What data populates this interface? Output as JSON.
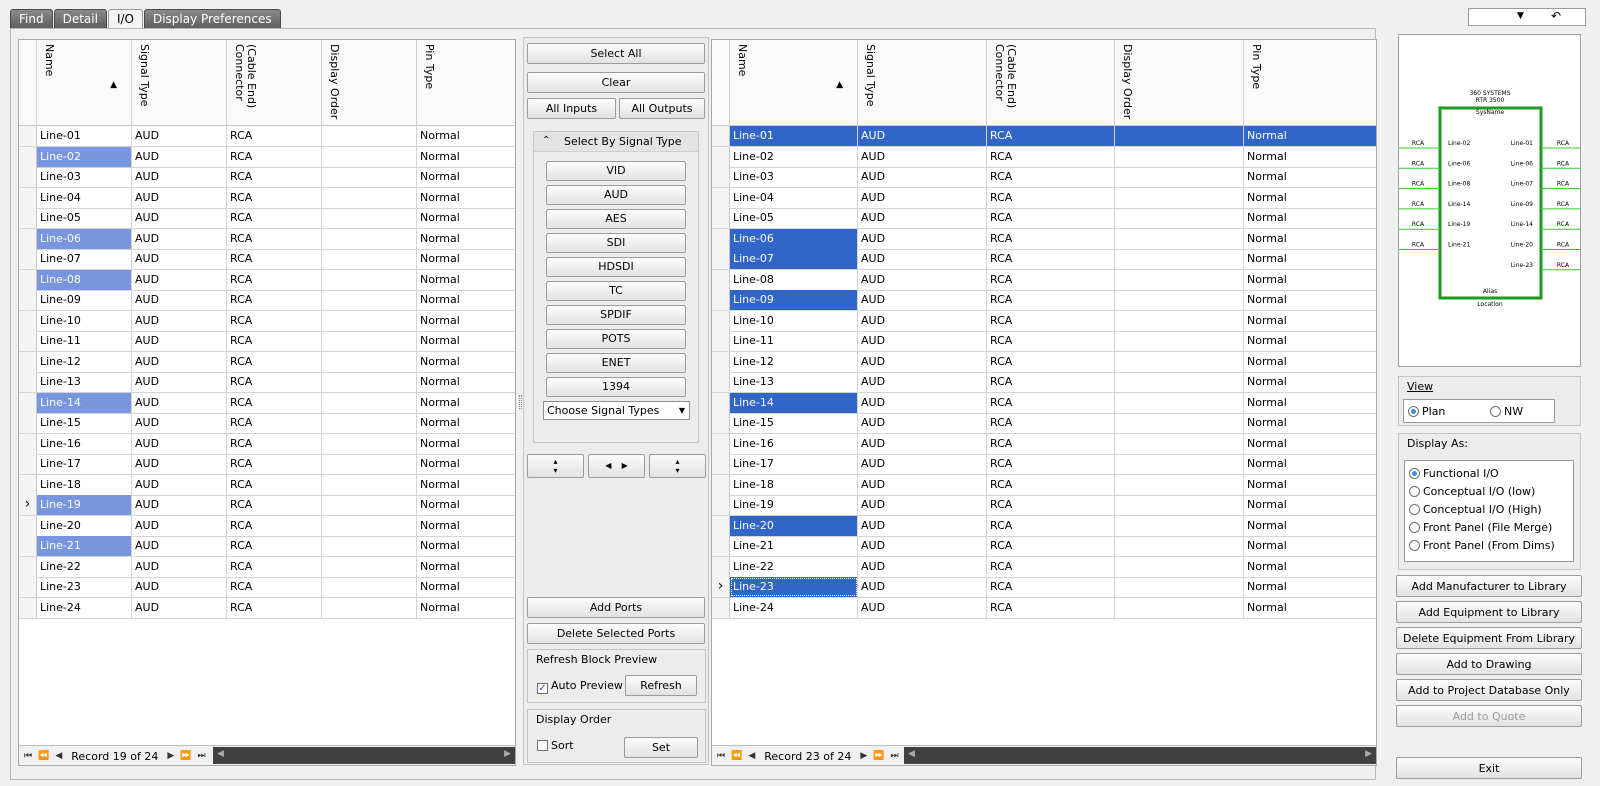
{
  "tabs": [
    {
      "label": "Find",
      "active": false
    },
    {
      "label": "Detail",
      "active": false
    },
    {
      "label": "I/O",
      "active": true
    },
    {
      "label": "Display Preferences",
      "active": false
    }
  ],
  "grid_columns": [
    "Name",
    "Signal Type",
    "(Cable End)\nConnector",
    "Display Order",
    "Pin Type"
  ],
  "left_grid": {
    "rows": [
      [
        "Line-01",
        "AUD",
        "RCA",
        "",
        "Normal"
      ],
      [
        "Line-02",
        "AUD",
        "RCA",
        "",
        "Normal"
      ],
      [
        "Line-03",
        "AUD",
        "RCA",
        "",
        "Normal"
      ],
      [
        "Line-04",
        "AUD",
        "RCA",
        "",
        "Normal"
      ],
      [
        "Line-05",
        "AUD",
        "RCA",
        "",
        "Normal"
      ],
      [
        "Line-06",
        "AUD",
        "RCA",
        "",
        "Normal"
      ],
      [
        "Line-07",
        "AUD",
        "RCA",
        "",
        "Normal"
      ],
      [
        "Line-08",
        "AUD",
        "RCA",
        "",
        "Normal"
      ],
      [
        "Line-09",
        "AUD",
        "RCA",
        "",
        "Normal"
      ],
      [
        "Line-10",
        "AUD",
        "RCA",
        "",
        "Normal"
      ],
      [
        "Line-11",
        "AUD",
        "RCA",
        "",
        "Normal"
      ],
      [
        "Line-12",
        "AUD",
        "RCA",
        "",
        "Normal"
      ],
      [
        "Line-13",
        "AUD",
        "RCA",
        "",
        "Normal"
      ],
      [
        "Line-14",
        "AUD",
        "RCA",
        "",
        "Normal"
      ],
      [
        "Line-15",
        "AUD",
        "RCA",
        "",
        "Normal"
      ],
      [
        "Line-16",
        "AUD",
        "RCA",
        "",
        "Normal"
      ],
      [
        "Line-17",
        "AUD",
        "RCA",
        "",
        "Normal"
      ],
      [
        "Line-18",
        "AUD",
        "RCA",
        "",
        "Normal"
      ],
      [
        "Line-19",
        "AUD",
        "RCA",
        "",
        "Normal"
      ],
      [
        "Line-20",
        "AUD",
        "RCA",
        "",
        "Normal"
      ],
      [
        "Line-21",
        "AUD",
        "RCA",
        "",
        "Normal"
      ],
      [
        "Line-22",
        "AUD",
        "RCA",
        "",
        "Normal"
      ],
      [
        "Line-23",
        "AUD",
        "RCA",
        "",
        "Normal"
      ],
      [
        "Line-24",
        "AUD",
        "RCA",
        "",
        "Normal"
      ]
    ],
    "selected_rows": [
      1,
      5,
      7,
      13,
      18,
      20
    ],
    "current_row": 18,
    "record_text": "Record 19 of 24"
  },
  "right_grid": {
    "rows": [
      [
        "Line-01",
        "AUD",
        "RCA",
        "",
        "Normal"
      ],
      [
        "Line-02",
        "AUD",
        "RCA",
        "",
        "Normal"
      ],
      [
        "Line-03",
        "AUD",
        "RCA",
        "",
        "Normal"
      ],
      [
        "Line-04",
        "AUD",
        "RCA",
        "",
        "Normal"
      ],
      [
        "Line-05",
        "AUD",
        "RCA",
        "",
        "Normal"
      ],
      [
        "Line-06",
        "AUD",
        "RCA",
        "",
        "Normal"
      ],
      [
        "Line-07",
        "AUD",
        "RCA",
        "",
        "Normal"
      ],
      [
        "Line-08",
        "AUD",
        "RCA",
        "",
        "Normal"
      ],
      [
        "Line-09",
        "AUD",
        "RCA",
        "",
        "Normal"
      ],
      [
        "Line-10",
        "AUD",
        "RCA",
        "",
        "Normal"
      ],
      [
        "Line-11",
        "AUD",
        "RCA",
        "",
        "Normal"
      ],
      [
        "Line-12",
        "AUD",
        "RCA",
        "",
        "Normal"
      ],
      [
        "Line-13",
        "AUD",
        "RCA",
        "",
        "Normal"
      ],
      [
        "Line-14",
        "AUD",
        "RCA",
        "",
        "Normal"
      ],
      [
        "Line-15",
        "AUD",
        "RCA",
        "",
        "Normal"
      ],
      [
        "Line-16",
        "AUD",
        "RCA",
        "",
        "Normal"
      ],
      [
        "Line-17",
        "AUD",
        "RCA",
        "",
        "Normal"
      ],
      [
        "Line-18",
        "AUD",
        "RCA",
        "",
        "Normal"
      ],
      [
        "Line-19",
        "AUD",
        "RCA",
        "",
        "Normal"
      ],
      [
        "Line-20",
        "AUD",
        "RCA",
        "",
        "Normal"
      ],
      [
        "Line-21",
        "AUD",
        "RCA",
        "",
        "Normal"
      ],
      [
        "Line-22",
        "AUD",
        "RCA",
        "",
        "Normal"
      ],
      [
        "Line-23",
        "AUD",
        "RCA",
        "",
        "Normal"
      ],
      [
        "Line-24",
        "AUD",
        "RCA",
        "",
        "Normal"
      ]
    ],
    "full_row_selected": 0,
    "selected_rows": [
      5,
      6,
      8,
      13,
      19,
      22
    ],
    "current_row": 22,
    "record_text": "Record 23 of 24"
  },
  "middle": {
    "select_all": "Select All",
    "clear": "Clear",
    "all_inputs": "All Inputs",
    "all_outputs": "All Outputs",
    "signal_panel_title": "Select By Signal Type",
    "signal_buttons": [
      "VID",
      "AUD",
      "AES",
      "SDI",
      "HDSDI",
      "TC",
      "SPDIF",
      "POTS",
      "ENET",
      "1394"
    ],
    "signal_combo": "Choose Signal Types",
    "add_ports": "Add Ports",
    "delete_ports": "Delete Selected Ports",
    "refresh_panel_title": "Refresh Block Preview",
    "auto_preview": "Auto Preview",
    "auto_preview_checked": true,
    "refresh": "Refresh",
    "order_panel_title": "Display Order",
    "sort": "Sort",
    "sort_checked": false,
    "set": "Set"
  },
  "preview": {
    "manufacturer": "360 SYSTEMS",
    "model": "RTR 3500",
    "sysname": "SysName",
    "alias": "Alias",
    "location": "Location",
    "left_ports": [
      "Line-02",
      "Line-06",
      "Line-08",
      "Line-14",
      "Line-19",
      "Line-21"
    ],
    "right_ports": [
      "Line-01",
      "Line-06",
      "Line-07",
      "Line-09",
      "Line-14",
      "Line-20",
      "Line-23"
    ],
    "connector": "RCA",
    "block_color": "#1e9a1e",
    "line_color": "#2ecc2e"
  },
  "view": {
    "title": "View",
    "options": [
      "Plan",
      "NW"
    ],
    "selected": 0
  },
  "display_as": {
    "title": "Display As:",
    "options": [
      "Functional I/O",
      "Conceptual I/O (low)",
      "Conceptual I/O (High)",
      "Front Panel (File Merge)",
      "Front Panel (From Dims)"
    ],
    "selected": 0
  },
  "actions": [
    {
      "label": "Add Manufacturer to Library",
      "enabled": true
    },
    {
      "label": "Add Equipment to Library",
      "enabled": true
    },
    {
      "label": "Delete Equipment From Library",
      "enabled": true
    },
    {
      "label": "Add to Drawing",
      "enabled": true
    },
    {
      "label": "Add to Project Database Only",
      "enabled": true
    },
    {
      "label": "Add to Quote",
      "enabled": false
    }
  ],
  "exit": "Exit"
}
